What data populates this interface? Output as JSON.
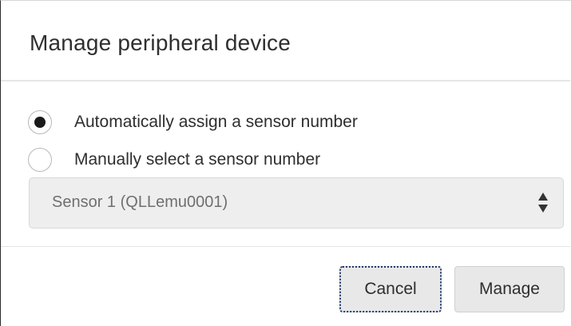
{
  "dialog": {
    "title": "Manage peripheral device"
  },
  "options": {
    "auto_label": "Automatically assign a sensor number",
    "manual_label": "Manually select a sensor number",
    "selected": "auto"
  },
  "sensor_select": {
    "value": "Sensor 1 (QLLemu0001)"
  },
  "footer": {
    "cancel_label": "Cancel",
    "manage_label": "Manage"
  }
}
